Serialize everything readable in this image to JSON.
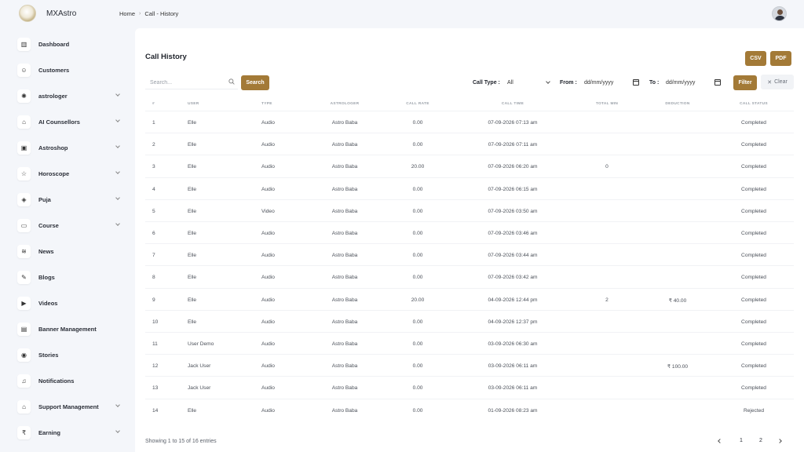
{
  "app": {
    "brand": "MXAstro"
  },
  "breadcrumb": {
    "home": "Home",
    "separator": "›",
    "current": "Call - History"
  },
  "sidebar": {
    "items": [
      {
        "label": "Dashboard",
        "icon": "dashboard-icon",
        "glyph": "▥",
        "has_submenu": false
      },
      {
        "label": "Customers",
        "icon": "users-icon",
        "glyph": "☺",
        "has_submenu": false
      },
      {
        "label": "astrologer",
        "icon": "astrologer-icon",
        "glyph": "✺",
        "has_submenu": true
      },
      {
        "label": "AI Counsellors",
        "icon": "ai-icon",
        "glyph": "⌂",
        "has_submenu": true
      },
      {
        "label": "Astroshop",
        "icon": "shop-icon",
        "glyph": "▣",
        "has_submenu": true
      },
      {
        "label": "Horoscope",
        "icon": "star-icon",
        "glyph": "☆",
        "has_submenu": true
      },
      {
        "label": "Puja",
        "icon": "puja-icon",
        "glyph": "◈",
        "has_submenu": true
      },
      {
        "label": "Course",
        "icon": "course-icon",
        "glyph": "▭",
        "has_submenu": true
      },
      {
        "label": "News",
        "icon": "rss-icon",
        "glyph": "≋",
        "has_submenu": false
      },
      {
        "label": "Blogs",
        "icon": "pen-icon",
        "glyph": "✎",
        "has_submenu": false
      },
      {
        "label": "Videos",
        "icon": "video-icon",
        "glyph": "▶",
        "has_submenu": false
      },
      {
        "label": "Banner Management",
        "icon": "banner-icon",
        "glyph": "▤",
        "has_submenu": false
      },
      {
        "label": "Stories",
        "icon": "stories-icon",
        "glyph": "◉",
        "has_submenu": false
      },
      {
        "label": "Notifications",
        "icon": "bell-icon",
        "glyph": "♫",
        "has_submenu": false
      },
      {
        "label": "Support Management",
        "icon": "support-icon",
        "glyph": "⌂",
        "has_submenu": true
      },
      {
        "label": "Earning",
        "icon": "rupee-icon",
        "glyph": "₹",
        "has_submenu": true
      }
    ]
  },
  "page": {
    "title": "Call History",
    "csv_label": "CSV",
    "pdf_label": "PDF"
  },
  "filters": {
    "search_placeholder": "Search...",
    "search_button": "Search",
    "call_type_label": "Call Type :",
    "call_type_value": "All",
    "from_label": "From :",
    "from_value": "dd/mm/yyyy",
    "to_label": "To :",
    "to_value": "dd/mm/yyyy",
    "filter_button": "Filter",
    "clear_button": "Clear"
  },
  "table": {
    "headers": [
      "#",
      "User",
      "Type",
      "Astrologer",
      "Call Rate",
      "Call Time",
      "Total Min",
      "Deduction",
      "Call Status"
    ],
    "rows": [
      [
        "1",
        "Elle",
        "Audio",
        "Astro Baba",
        "0.00",
        "07-09-2026 07:13 am",
        "",
        "",
        "Completed"
      ],
      [
        "2",
        "Elle",
        "Audio",
        "Astro Baba",
        "0.00",
        "07-09-2026 07:11 am",
        "",
        "",
        "Completed"
      ],
      [
        "3",
        "Elle",
        "Audio",
        "Astro Baba",
        "20.00",
        "07-09-2026 06:20 am",
        "0",
        "",
        "Completed"
      ],
      [
        "4",
        "Elle",
        "Audio",
        "Astro Baba",
        "0.00",
        "07-09-2026 06:15 am",
        "",
        "",
        "Completed"
      ],
      [
        "5",
        "Elle",
        "Video",
        "Astro Baba",
        "0.00",
        "07-09-2026 03:50 am",
        "",
        "",
        "Completed"
      ],
      [
        "6",
        "Elle",
        "Audio",
        "Astro Baba",
        "0.00",
        "07-09-2026 03:46 am",
        "",
        "",
        "Completed"
      ],
      [
        "7",
        "Elle",
        "Audio",
        "Astro Baba",
        "0.00",
        "07-09-2026 03:44 am",
        "",
        "",
        "Completed"
      ],
      [
        "8",
        "Elle",
        "Audio",
        "Astro Baba",
        "0.00",
        "07-09-2026 03:42 am",
        "",
        "",
        "Completed"
      ],
      [
        "9",
        "Elle",
        "Audio",
        "Astro Baba",
        "20.00",
        "04-09-2026 12:44 pm",
        "2",
        "₹ 40.00",
        "Completed"
      ],
      [
        "10",
        "Elle",
        "Audio",
        "Astro Baba",
        "0.00",
        "04-09-2026 12:37 pm",
        "",
        "",
        "Completed"
      ],
      [
        "11",
        "User Demo",
        "Audio",
        "Astro Baba",
        "0.00",
        "03-09-2026 06:30 am",
        "",
        "",
        "Completed"
      ],
      [
        "12",
        "Jack User",
        "Audio",
        "Astro Baba",
        "0.00",
        "03-09-2026 06:11 am",
        "",
        "₹ 100.00",
        "Completed"
      ],
      [
        "13",
        "Jack User",
        "Audio",
        "Astro Baba",
        "0.00",
        "03-09-2026 06:11 am",
        "",
        "",
        "Completed"
      ],
      [
        "14",
        "Elle",
        "Audio",
        "Astro Baba",
        "0.00",
        "01-09-2026 08:23 am",
        "",
        "",
        "Rejected"
      ]
    ]
  },
  "footer": {
    "info": "Showing 1 to 15 of 16 entries",
    "pages": [
      "1",
      "2"
    ]
  },
  "colors": {
    "accent": "#a37a37",
    "background": "#f4f6fa",
    "card": "#ffffff"
  }
}
